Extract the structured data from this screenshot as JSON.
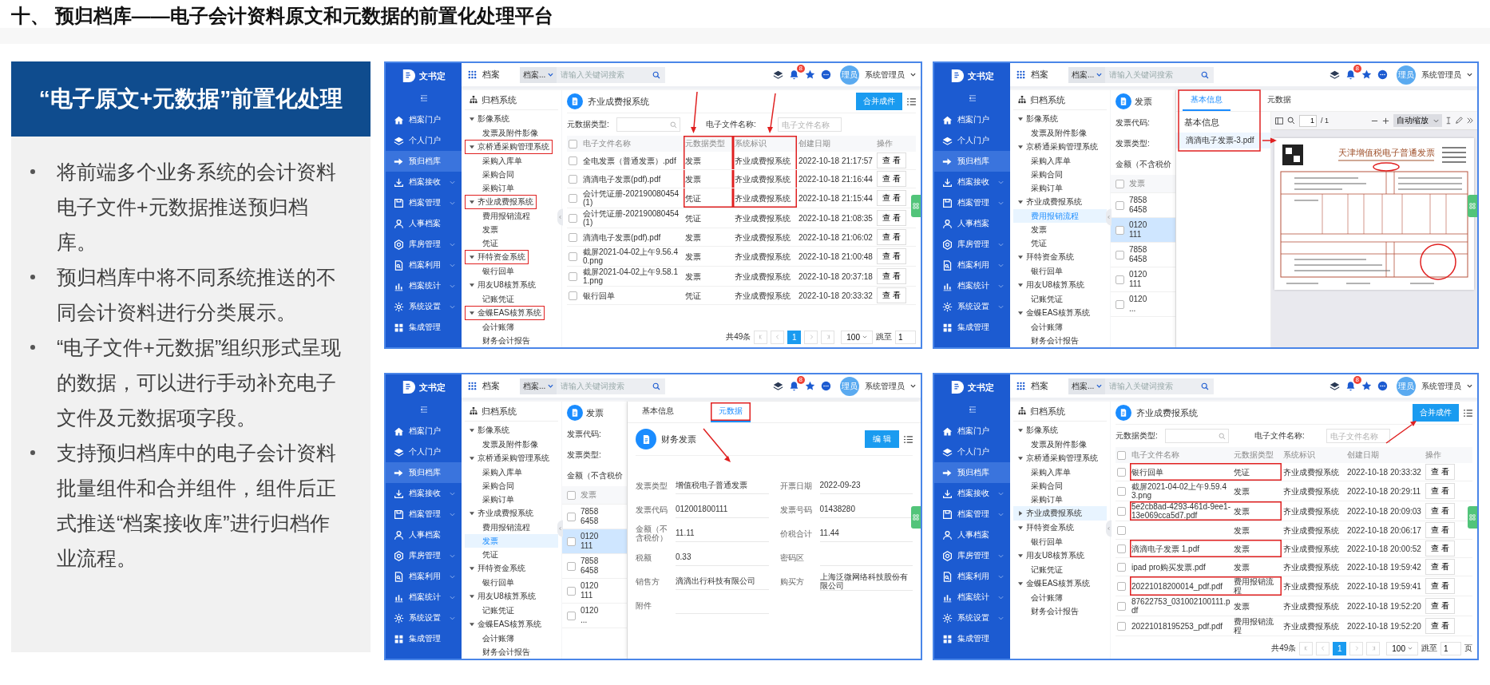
{
  "title": "十、 预归档库——电子会计资料原文和元数据的前置化处理平台",
  "panel": {
    "heading": "“电子原文+元数据”前置化处理",
    "bullets": [
      "将前端多个业务系统的会计资料电子文件+元数据推送预归档库。",
      "预归档库中将不同系统推送的不同会计资料进行分类展示。",
      "“电子文件+元数据”组织形式呈现的数据，可以进行手动补充电子文件及元数据项字段。",
      "支持预归档库中的电子会计资料批量组件和合并组件，组件后正式推送“档案接收库”进行归档作业流程。"
    ]
  },
  "screens": [
    {
      "kind": "list",
      "logo": "文书定",
      "app": "档案",
      "scope": "档案...",
      "search_placeholder": "请输入关键词搜索",
      "badge": "8",
      "avatar": "理员",
      "user": "系统管理员",
      "nav": [
        {
          "label": "档案门户",
          "selected": false,
          "expandable": false
        },
        {
          "label": "个人门户",
          "selected": false,
          "expandable": false
        },
        {
          "label": "预归档库",
          "selected": true,
          "expandable": false
        },
        {
          "label": "档案接收",
          "selected": false,
          "expandable": true
        },
        {
          "label": "档案管理",
          "selected": false,
          "expandable": true
        },
        {
          "label": "人事档案",
          "selected": false,
          "expandable": false
        },
        {
          "label": "库房管理",
          "selected": false,
          "expandable": true
        },
        {
          "label": "档案利用",
          "selected": false,
          "expandable": true
        },
        {
          "label": "档案统计",
          "selected": false,
          "expandable": true
        },
        {
          "label": "系统设置",
          "selected": false,
          "expandable": true
        },
        {
          "label": "集成管理",
          "selected": false,
          "expandable": false
        }
      ],
      "tree": {
        "title": "归档系统",
        "items": [
          {
            "label": "影像系统",
            "expanded": true,
            "selected": false,
            "marked": false,
            "children": [
              {
                "label": "发票及附件影像",
                "selected": false
              }
            ]
          },
          {
            "label": "京桥通采购管理系统",
            "expanded": true,
            "selected": false,
            "marked": true,
            "children": [
              {
                "label": "采购入库单",
                "selected": false
              },
              {
                "label": "采购合同",
                "selected": false
              },
              {
                "label": "采购订单",
                "selected": false
              }
            ]
          },
          {
            "label": "齐业成费报系统",
            "expanded": true,
            "selected": false,
            "marked": true,
            "children": [
              {
                "label": "费用报销流程",
                "selected": false
              },
              {
                "label": "发票",
                "selected": false
              },
              {
                "label": "凭证",
                "selected": false
              }
            ]
          },
          {
            "label": "拜特资金系统",
            "expanded": true,
            "selected": false,
            "marked": true,
            "children": [
              {
                "label": "银行回单",
                "selected": false
              }
            ]
          },
          {
            "label": "用友U8核算系统",
            "expanded": true,
            "selected": false,
            "marked": false,
            "children": [
              {
                "label": "记账凭证",
                "selected": false
              }
            ]
          },
          {
            "label": "金蝶EAS核算系统",
            "expanded": true,
            "selected": false,
            "marked": true,
            "children": [
              {
                "label": "会计账簿",
                "selected": false
              },
              {
                "label": "财务会计报告",
                "selected": false
              }
            ]
          }
        ]
      },
      "list": {
        "title": "齐业成费报系统",
        "merge": "合并成件",
        "filter_type": "元数据类型:",
        "filter_name": "电子文件名称:",
        "name_placeholder": "电子文件名称",
        "all_checked": false,
        "columns": [
          {
            "label": "电子文件名称",
            "marked": false
          },
          {
            "label": "元数据类型",
            "marked": true
          },
          {
            "label": "系统标识",
            "marked": true
          },
          {
            "label": "创建日期",
            "marked": false
          },
          {
            "label": "操作",
            "marked": false
          }
        ],
        "rows": [
          {
            "name": "全电发票（普通发票）.pdf",
            "type": "发票",
            "system": "齐业成费报系统",
            "date": "2022-10-18 21:17:57",
            "action": "查 看",
            "marked": true,
            "checked": false
          },
          {
            "name": "滴滴电子发票(pdf).pdf",
            "type": "发票",
            "system": "齐业成费报系统",
            "date": "2022-10-18 21:16:44",
            "action": "查 看",
            "marked": true,
            "checked": false
          },
          {
            "name": "会计凭证册-202190080454(1)",
            "type": "凭证",
            "system": "齐业成费报系统",
            "date": "2022-10-18 21:15:44",
            "action": "查 看",
            "marked": true,
            "checked": false
          },
          {
            "name": "会计凭证册-202190080454(1)",
            "type": "凭证",
            "system": "齐业成费报系统",
            "date": "2022-10-18 21:08:35",
            "action": "查 看",
            "marked": false,
            "checked": false
          },
          {
            "name": "滴滴电子发票(pdf).pdf",
            "type": "发票",
            "system": "齐业成费报系统",
            "date": "2022-10-18 21:06:02",
            "action": "查 看",
            "marked": false,
            "checked": false
          },
          {
            "name": "截屏2021-04-02上午9.56.40.png",
            "type": "发票",
            "system": "齐业成费报系统",
            "date": "2022-10-18 21:00:48",
            "action": "查 看",
            "marked": false,
            "checked": false
          },
          {
            "name": "截屏2021-04-02上午9.58.11.png",
            "type": "发票",
            "system": "齐业成费报系统",
            "date": "2022-10-18 20:37:18",
            "action": "查 看",
            "marked": false,
            "checked": false
          },
          {
            "name": "银行回单",
            "type": "凭证",
            "system": "齐业成费报系统",
            "date": "2022-10-18 20:33:32",
            "action": "查 看",
            "marked": false,
            "checked": false
          }
        ],
        "pager": {
          "total": "共49条",
          "pages": [
            {
              "label": "1",
              "selected": true
            }
          ],
          "size": "100",
          "jump": "跳至",
          "jump_value": "1"
        }
      }
    },
    {
      "kind": "preview",
      "logo": "文书定",
      "app": "档案",
      "scope": "档案...",
      "search_placeholder": "请输入关键词搜索",
      "badge": "8",
      "avatar": "理员",
      "user": "系统管理员",
      "nav": [
        {
          "label": "档案门户",
          "selected": false,
          "expandable": false
        },
        {
          "label": "个人门户",
          "selected": false,
          "expandable": false
        },
        {
          "label": "预归档库",
          "selected": true,
          "expandable": false
        },
        {
          "label": "档案接收",
          "selected": false,
          "expandable": true
        },
        {
          "label": "档案管理",
          "selected": false,
          "expandable": true
        },
        {
          "label": "人事档案",
          "selected": false,
          "expandable": false
        },
        {
          "label": "库房管理",
          "selected": false,
          "expandable": true
        },
        {
          "label": "档案利用",
          "selected": false,
          "expandable": true
        },
        {
          "label": "档案统计",
          "selected": false,
          "expandable": true
        },
        {
          "label": "系统设置",
          "selected": false,
          "expandable": true
        },
        {
          "label": "集成管理",
          "selected": false,
          "expandable": false
        }
      ],
      "tree": {
        "title": "归档系统",
        "items": [
          {
            "label": "影像系统",
            "expanded": true,
            "selected": false,
            "marked": false,
            "children": [
              {
                "label": "发票及附件影像",
                "selected": false
              }
            ]
          },
          {
            "label": "京桥通采购管理系统",
            "expanded": true,
            "selected": false,
            "marked": false,
            "children": [
              {
                "label": "采购入库单",
                "selected": false
              },
              {
                "label": "采购合同",
                "selected": false
              },
              {
                "label": "采购订单",
                "selected": false
              }
            ]
          },
          {
            "label": "齐业成费报系统",
            "expanded": true,
            "selected": false,
            "marked": false,
            "children": [
              {
                "label": "费用报销流程",
                "selected": true
              },
              {
                "label": "发票",
                "selected": false
              },
              {
                "label": "凭证",
                "selected": false
              }
            ]
          },
          {
            "label": "拜特资金系统",
            "expanded": true,
            "selected": false,
            "marked": false,
            "children": [
              {
                "label": "银行回单",
                "selected": false
              }
            ]
          },
          {
            "label": "用友U8核算系统",
            "expanded": true,
            "selected": false,
            "marked": false,
            "children": [
              {
                "label": "记账凭证",
                "selected": false
              }
            ]
          },
          {
            "label": "金蝶EAS核算系统",
            "expanded": true,
            "selected": false,
            "marked": false,
            "children": [
              {
                "label": "会计账簿",
                "selected": false
              },
              {
                "label": "财务会计报告",
                "selected": false
              }
            ]
          }
        ]
      },
      "backdrop": {
        "title": "发票",
        "fields": [
          "发票代码:",
          "发票类型:",
          "金额（不含税价"
        ],
        "header": "发票",
        "all_checked": false,
        "rows": [
          {
            "text": "7858 6458",
            "selected": false,
            "checked": false
          },
          {
            "text": "0120 111",
            "selected": true,
            "checked": false
          },
          {
            "text": "7858 6458",
            "selected": false,
            "checked": false
          },
          {
            "text": "0120 111",
            "selected": false,
            "checked": false
          },
          {
            "text": "0120 ...",
            "selected": false,
            "checked": false
          }
        ]
      },
      "drawer": {
        "tabs": [
          {
            "label": "基本信息",
            "selected": true,
            "marked": false
          },
          {
            "label": "元数据",
            "selected": false,
            "marked": false
          }
        ],
        "list_title": "基本信息",
        "files": [
          {
            "label": "滴滴电子发票-3.pdf",
            "selected": true
          }
        ],
        "pdf": {
          "page": "1",
          "pages": "/ 1",
          "zoom": "自动缩放",
          "invoice_title": "天津增值税电子普通发票"
        }
      }
    },
    {
      "kind": "metadata",
      "logo": "文书定",
      "app": "档案",
      "scope": "档案...",
      "search_placeholder": "请输入关键词搜索",
      "badge": "8",
      "avatar": "理员",
      "user": "系统管理员",
      "nav": [
        {
          "label": "档案门户",
          "selected": false,
          "expandable": false
        },
        {
          "label": "个人门户",
          "selected": false,
          "expandable": false
        },
        {
          "label": "预归档库",
          "selected": true,
          "expandable": false
        },
        {
          "label": "档案接收",
          "selected": false,
          "expandable": true
        },
        {
          "label": "档案管理",
          "selected": false,
          "expandable": true
        },
        {
          "label": "人事档案",
          "selected": false,
          "expandable": false
        },
        {
          "label": "库房管理",
          "selected": false,
          "expandable": true
        },
        {
          "label": "档案利用",
          "selected": false,
          "expandable": true
        },
        {
          "label": "档案统计",
          "selected": false,
          "expandable": true
        },
        {
          "label": "系统设置",
          "selected": false,
          "expandable": true
        },
        {
          "label": "集成管理",
          "selected": false,
          "expandable": false
        }
      ],
      "tree": {
        "title": "归档系统",
        "items": [
          {
            "label": "影像系统",
            "expanded": true,
            "selected": false,
            "marked": false,
            "children": [
              {
                "label": "发票及附件影像",
                "selected": false
              }
            ]
          },
          {
            "label": "京桥通采购管理系统",
            "expanded": true,
            "selected": false,
            "marked": false,
            "children": [
              {
                "label": "采购入库单",
                "selected": false
              },
              {
                "label": "采购合同",
                "selected": false
              },
              {
                "label": "采购订单",
                "selected": false
              }
            ]
          },
          {
            "label": "齐业成费报系统",
            "expanded": true,
            "selected": false,
            "marked": false,
            "children": [
              {
                "label": "费用报销流程",
                "selected": false
              },
              {
                "label": "发票",
                "selected": true
              },
              {
                "label": "凭证",
                "selected": false
              }
            ]
          },
          {
            "label": "拜特资金系统",
            "expanded": true,
            "selected": false,
            "marked": false,
            "children": [
              {
                "label": "银行回单",
                "selected": false
              }
            ]
          },
          {
            "label": "用友U8核算系统",
            "expanded": true,
            "selected": false,
            "marked": false,
            "children": [
              {
                "label": "记账凭证",
                "selected": false
              }
            ]
          },
          {
            "label": "金蝶EAS核算系统",
            "expanded": true,
            "selected": false,
            "marked": false,
            "children": [
              {
                "label": "会计账簿",
                "selected": false
              },
              {
                "label": "财务会计报告",
                "selected": false
              }
            ]
          }
        ]
      },
      "backdrop": {
        "title": "发票",
        "fields": [
          "发票代码:",
          "发票类型:",
          "金额（不含税价"
        ],
        "header": "发票",
        "all_checked": false,
        "rows": [
          {
            "text": "7858 6458",
            "selected": false,
            "checked": false
          },
          {
            "text": "0120 111",
            "selected": true,
            "checked": false
          },
          {
            "text": "7858 6458",
            "selected": false,
            "checked": false
          },
          {
            "text": "0120 111",
            "selected": false,
            "checked": false
          },
          {
            "text": "0120 ...",
            "selected": false,
            "checked": false
          }
        ]
      },
      "drawer": {
        "tabs": [
          {
            "label": "基本信息",
            "selected": false,
            "marked": false
          },
          {
            "label": "元数据",
            "selected": true,
            "marked": true
          }
        ],
        "record": {
          "title": "财务发票",
          "edit": "编 辑",
          "fields": [
            {
              "label": "发票类型",
              "value": "增值税电子普通发票"
            },
            {
              "label": "开票日期",
              "value": "2022-09-23"
            },
            {
              "label": "发票代码",
              "value": "012001800111"
            },
            {
              "label": "发票号码",
              "value": "01438280"
            },
            {
              "label": "金额（不含税价）",
              "value": "11.11"
            },
            {
              "label": "价税合计",
              "value": "11.44"
            },
            {
              "label": "税额",
              "value": "0.33"
            },
            {
              "label": "密码区"
            },
            {
              "label": "销售方",
              "value": "滴滴出行科技有限公司"
            },
            {
              "label": "购买方",
              "value": "上海泛微网络科技股份有限公司"
            },
            {
              "label": "附件"
            }
          ]
        }
      }
    },
    {
      "kind": "list",
      "logo": "文书定",
      "app": "档案",
      "scope": "档案...",
      "search_placeholder": "请输入关键词搜索",
      "badge": "8",
      "avatar": "理员",
      "user": "系统管理员",
      "nav": [
        {
          "label": "档案门户",
          "selected": false,
          "expandable": false
        },
        {
          "label": "个人门户",
          "selected": false,
          "expandable": false
        },
        {
          "label": "预归档库",
          "selected": true,
          "expandable": false
        },
        {
          "label": "档案接收",
          "selected": false,
          "expandable": true
        },
        {
          "label": "档案管理",
          "selected": false,
          "expandable": true
        },
        {
          "label": "人事档案",
          "selected": false,
          "expandable": false
        },
        {
          "label": "库房管理",
          "selected": false,
          "expandable": true
        },
        {
          "label": "档案利用",
          "selected": false,
          "expandable": true
        },
        {
          "label": "档案统计",
          "selected": false,
          "expandable": true
        },
        {
          "label": "系统设置",
          "selected": false,
          "expandable": true
        },
        {
          "label": "集成管理",
          "selected": false,
          "expandable": false
        }
      ],
      "tree": {
        "title": "归档系统",
        "items": [
          {
            "label": "影像系统",
            "expanded": true,
            "selected": false,
            "marked": false,
            "children": [
              {
                "label": "发票及附件影像",
                "selected": false
              }
            ]
          },
          {
            "label": "京桥通采购管理系统",
            "expanded": true,
            "selected": false,
            "marked": false,
            "children": [
              {
                "label": "采购入库单",
                "selected": false
              },
              {
                "label": "采购合同",
                "selected": false
              },
              {
                "label": "采购订单",
                "selected": false
              }
            ]
          },
          {
            "label": "齐业成费报系统",
            "expanded": false,
            "selected": true,
            "marked": false
          },
          {
            "label": "拜特资金系统",
            "expanded": true,
            "selected": false,
            "marked": false,
            "children": [
              {
                "label": "银行回单",
                "selected": false
              }
            ]
          },
          {
            "label": "用友U8核算系统",
            "expanded": true,
            "selected": false,
            "marked": false,
            "children": [
              {
                "label": "记账凭证",
                "selected": false
              }
            ]
          },
          {
            "label": "金蝶EAS核算系统",
            "expanded": true,
            "selected": false,
            "marked": false,
            "children": [
              {
                "label": "会计账簿",
                "selected": false
              },
              {
                "label": "财务会计报告",
                "selected": false
              }
            ]
          }
        ]
      },
      "list": {
        "title": "齐业成费报系统",
        "merge": "合并成件",
        "filter_type": "元数据类型:",
        "filter_name": "电子文件名称:",
        "name_placeholder": "电子文件名称",
        "all_checked": false,
        "columns": [
          {
            "label": "电子文件名称"
          },
          {
            "label": "元数据类型"
          },
          {
            "label": "系统标识"
          },
          {
            "label": "创建日期"
          },
          {
            "label": "操作"
          }
        ],
        "rows": [
          {
            "name": "银行回单",
            "type": "凭证",
            "system": "齐业成费报系统",
            "date": "2022-10-18 20:33:32",
            "action": "查 看",
            "marked": true,
            "checked": false
          },
          {
            "name": "截屏2021-04-02上午9.59.43.png",
            "type": "发票",
            "system": "齐业成费报系统",
            "date": "2022-10-18 20:29:11",
            "action": "查 看",
            "marked": false,
            "checked": false
          },
          {
            "name": "5e2cb8ad-4293-461d-9ee1-13e069cca5d7.pdf",
            "type": "发票",
            "system": "齐业成费报系统",
            "date": "2022-10-18 20:09:03",
            "action": "查 看",
            "marked": true,
            "checked": false
          },
          {
            "type": "发票",
            "system": "齐业成费报系统",
            "date": "2022-10-18 20:06:17",
            "action": "查 看",
            "marked": false,
            "checked": false
          },
          {
            "name": "滴滴电子发票 1.pdf",
            "type": "发票",
            "system": "齐业成费报系统",
            "date": "2022-10-18 20:00:52",
            "action": "查 看",
            "marked": true,
            "checked": false
          },
          {
            "name": "ipad pro购买发票.pdf",
            "type": "发票",
            "system": "齐业成费报系统",
            "date": "2022-10-18 19:59:42",
            "action": "查 看",
            "marked": false,
            "checked": false
          },
          {
            "name": "20221018200014_pdf.pdf",
            "type": "费用报销流程",
            "system": "齐业成费报系统",
            "date": "2022-10-18 19:59:41",
            "action": "查 看",
            "marked": true,
            "checked": false
          },
          {
            "name": "87622753_031002100111.pdf",
            "type": "发票",
            "system": "齐业成费报系统",
            "date": "2022-10-18 19:52:20",
            "action": "查 看",
            "marked": false,
            "checked": false
          },
          {
            "name": "20221018195253_pdf.pdf",
            "type": "费用报销流程",
            "system": "齐业成费报系统",
            "date": "2022-10-18 19:52:20",
            "action": "查 看",
            "marked": false,
            "checked": false
          }
        ],
        "pager": {
          "total": "共49条",
          "pages": [
            {
              "label": "1",
              "selected": true
            }
          ],
          "size": "100",
          "jump": "跳至",
          "jump_value": "1",
          "suffix": "页"
        }
      }
    }
  ]
}
